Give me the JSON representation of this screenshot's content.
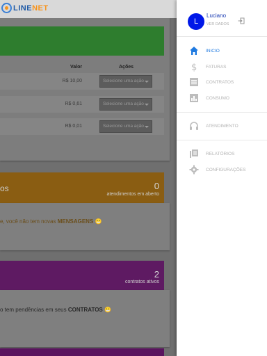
{
  "brand": {
    "logo_line": "LINE",
    "logo_net": "NET"
  },
  "table": {
    "col_valor": "Valor",
    "col_acoes": "Ações",
    "rows": [
      {
        "valor": "R$ 10,00",
        "select": "Selecione uma ação"
      },
      {
        "valor": "R$ 0,61",
        "select": "Selecione uma ação"
      },
      {
        "valor": "R$ 0,01",
        "select": "Selecione uma ação"
      }
    ]
  },
  "atendimentos": {
    "title_fragment": "os",
    "count": "0",
    "label": "atendimentos em aberto",
    "message_prefix": "e, você não tem novas ",
    "message_strong": "MENSAGENS",
    "emoji": "😬"
  },
  "contratos": {
    "count": "2",
    "label": "contratos ativos",
    "message_prefix": "o tem pendências em seus ",
    "message_strong": "CONTRATOS",
    "emoji": "😬"
  },
  "user": {
    "initial": "L",
    "name": "Luciano",
    "subtitle": "VER DADOS"
  },
  "nav": {
    "inicio": "INICIO",
    "faturas": "FATURAS",
    "contratos": "CONTRATOS",
    "consumo": "CONSUMO",
    "atendimento": "ATENDIMENTO",
    "relatorios": "RELATÓRIOS",
    "configuracoes": "CONFIGURAÇÕES"
  },
  "colors": {
    "accent": "#1f7ae0",
    "avatar": "#0018e8",
    "green": "#4caf50",
    "orange": "#f39c12",
    "purple": "#9c27b0"
  }
}
